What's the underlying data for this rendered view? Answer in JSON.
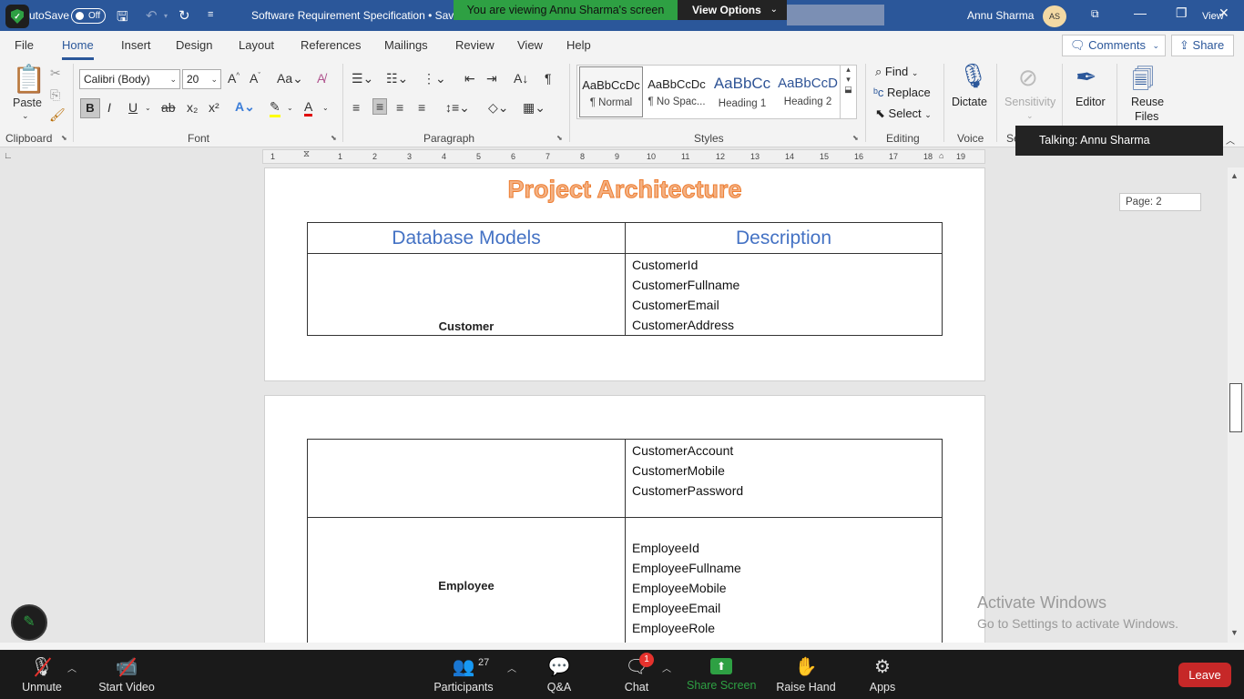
{
  "titlebar": {
    "autosave_label": "utoSave",
    "autosave_state": "Off",
    "doc_title": "Software Requirement Specification • Save",
    "share_banner": "You are viewing Annu Sharma's screen",
    "view_options": "View Options",
    "user_name": "Annu Sharma",
    "user_initials": "AS",
    "view_small": "View"
  },
  "menu": {
    "tabs": [
      "File",
      "Home",
      "Insert",
      "Design",
      "Layout",
      "References",
      "Mailings",
      "Review",
      "View",
      "Help"
    ],
    "active": "Home",
    "comments_label": "Comments",
    "share_label": "Share"
  },
  "ribbon": {
    "clipboard": {
      "paste_label": "Paste",
      "group_label": "Clipboard"
    },
    "font": {
      "font_name": "Calibri (Body)",
      "font_size": "20",
      "group_label": "Font",
      "bold": "B",
      "italic": "I",
      "underline": "U"
    },
    "paragraph": {
      "group_label": "Paragraph"
    },
    "styles": {
      "group_label": "Styles",
      "items": [
        {
          "sample": "AaBbCcDc",
          "name": "¶ Normal"
        },
        {
          "sample": "AaBbCcDc",
          "name": "¶ No Spac..."
        },
        {
          "sample": "AaBbCc",
          "name": "Heading 1"
        },
        {
          "sample": "AaBbCcD",
          "name": "Heading 2"
        }
      ]
    },
    "editing": {
      "find": "Find",
      "replace": "Replace",
      "select": "Select",
      "group_label": "Editing"
    },
    "voice": {
      "dictate": "Dictate",
      "group_label": "Voice"
    },
    "sensitivity": {
      "label": "Sensitivity",
      "group_label": "Se"
    },
    "editor": {
      "label": "Editor"
    },
    "reuse": {
      "label_line1": "Reuse",
      "label_line2": "Files"
    }
  },
  "talking": "Talking: Annu Sharma",
  "ruler": {
    "marks": [
      "1",
      "1",
      "2",
      "3",
      "4",
      "5",
      "6",
      "7",
      "8",
      "9",
      "10",
      "11",
      "12",
      "13",
      "14",
      "15",
      "16",
      "17",
      "18",
      "19"
    ]
  },
  "document": {
    "page_indicator": "Page: 2",
    "page1": {
      "title": "Project Architecture",
      "header_left": "Database Models",
      "header_right": "Description",
      "model": "Customer",
      "fields": [
        "CustomerId",
        "CustomerFullname",
        "CustomerEmail",
        "CustomerAddress"
      ]
    },
    "page2": {
      "cont_fields": [
        "CustomerAccount",
        "CustomerMobile",
        "CustomerPassword"
      ],
      "model": "Employee",
      "fields": [
        "EmployeeId",
        "EmployeeFullname",
        "EmployeeMobile",
        "EmployeeEmail",
        "EmployeeRole"
      ]
    }
  },
  "watermark": {
    "line1": "Activate Windows",
    "line2": "Go to Settings to activate Windows."
  },
  "zoom_toolbar": {
    "unmute": "Unmute",
    "start_video": "Start Video",
    "participants": "Participants",
    "participants_count": "27",
    "qa": "Q&A",
    "chat": "Chat",
    "chat_badge": "1",
    "share_screen": "Share Screen",
    "raise_hand": "Raise Hand",
    "apps": "Apps",
    "leave": "Leave"
  },
  "colors": {
    "word_blue": "#2b579a",
    "zoom_green": "#2ea043",
    "leave_red": "#c62828",
    "title_orange": "#f4b183"
  }
}
